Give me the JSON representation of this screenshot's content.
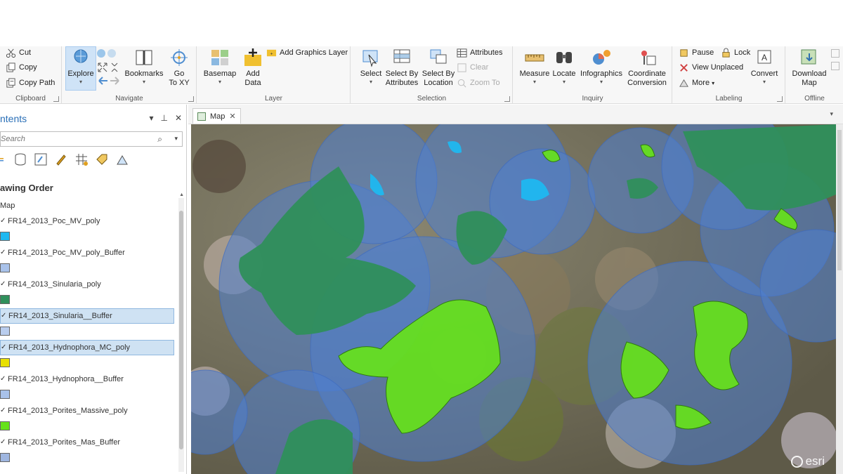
{
  "ribbon": {
    "clipboard": {
      "cut": "Cut",
      "copy": "Copy",
      "copy_path": "Copy Path",
      "label": "Clipboard"
    },
    "navigate": {
      "explore": "Explore",
      "bookmarks": "Bookmarks",
      "go_to_xy_1": "Go",
      "go_to_xy_2": "To XY",
      "label": "Navigate"
    },
    "layer": {
      "basemap": "Basemap",
      "add_data_1": "Add",
      "add_data_2": "Data",
      "add_graphics_layer": "Add Graphics Layer",
      "label": "Layer"
    },
    "selection": {
      "select": "Select",
      "select_by_attributes_1": "Select By",
      "select_by_attributes_2": "Attributes",
      "select_by_location_1": "Select By",
      "select_by_location_2": "Location",
      "attributes": "Attributes",
      "clear": "Clear",
      "zoom_to": "Zoom To",
      "label": "Selection"
    },
    "inquiry": {
      "measure": "Measure",
      "locate": "Locate",
      "infographics": "Infographics",
      "coordinate_conversion_1": "Coordinate",
      "coordinate_conversion_2": "Conversion",
      "label": "Inquiry"
    },
    "labeling": {
      "pause": "Pause",
      "lock": "Lock",
      "view_unplaced": "View Unplaced",
      "more": "More",
      "convert": "Convert",
      "label": "Labeling"
    },
    "offline": {
      "download_map_1": "Download",
      "download_map_2": "Map",
      "label": "Offline"
    }
  },
  "contents": {
    "title": "ntents",
    "search_placeholder": "Search",
    "heading": "awing Order",
    "map_node": "Map",
    "layers": [
      {
        "name": "FR14_2013_Poc_MV_poly",
        "color": "#1fb8f0",
        "selected": false
      },
      {
        "name": "FR14_2013_Poc_MV_poly_Buffer",
        "color": "#a9c2ea",
        "selected": false
      },
      {
        "name": "FR14_2013_Sinularia_poly",
        "color": "#2f8f5b",
        "selected": false
      },
      {
        "name": "FR14_2013_Sinularia__Buffer",
        "color": "#b9cdee",
        "selected": true
      },
      {
        "name": "FR14_2013_Hydnophora_MC_poly",
        "color": "#e8e000",
        "selected": true
      },
      {
        "name": "FR14_2013_Hydnophora__Buffer",
        "color": "#a9c2ea",
        "selected": false
      },
      {
        "name": "FR14_2013_Porites_Massive_poly",
        "color": "#66e21a",
        "selected": false
      },
      {
        "name": "FR14_2013_Porites_Mas_Buffer",
        "color": "#9fb6e0",
        "selected": false
      }
    ]
  },
  "map": {
    "tab_label": "Map",
    "watermark": "esri"
  },
  "colors": {
    "accent": "#2a6fb7",
    "buffer_blue": "#5b86d6",
    "sinularia_green": "#2f8f5b",
    "porites_green": "#66e21a",
    "poc_cyan": "#1fb8f0"
  }
}
